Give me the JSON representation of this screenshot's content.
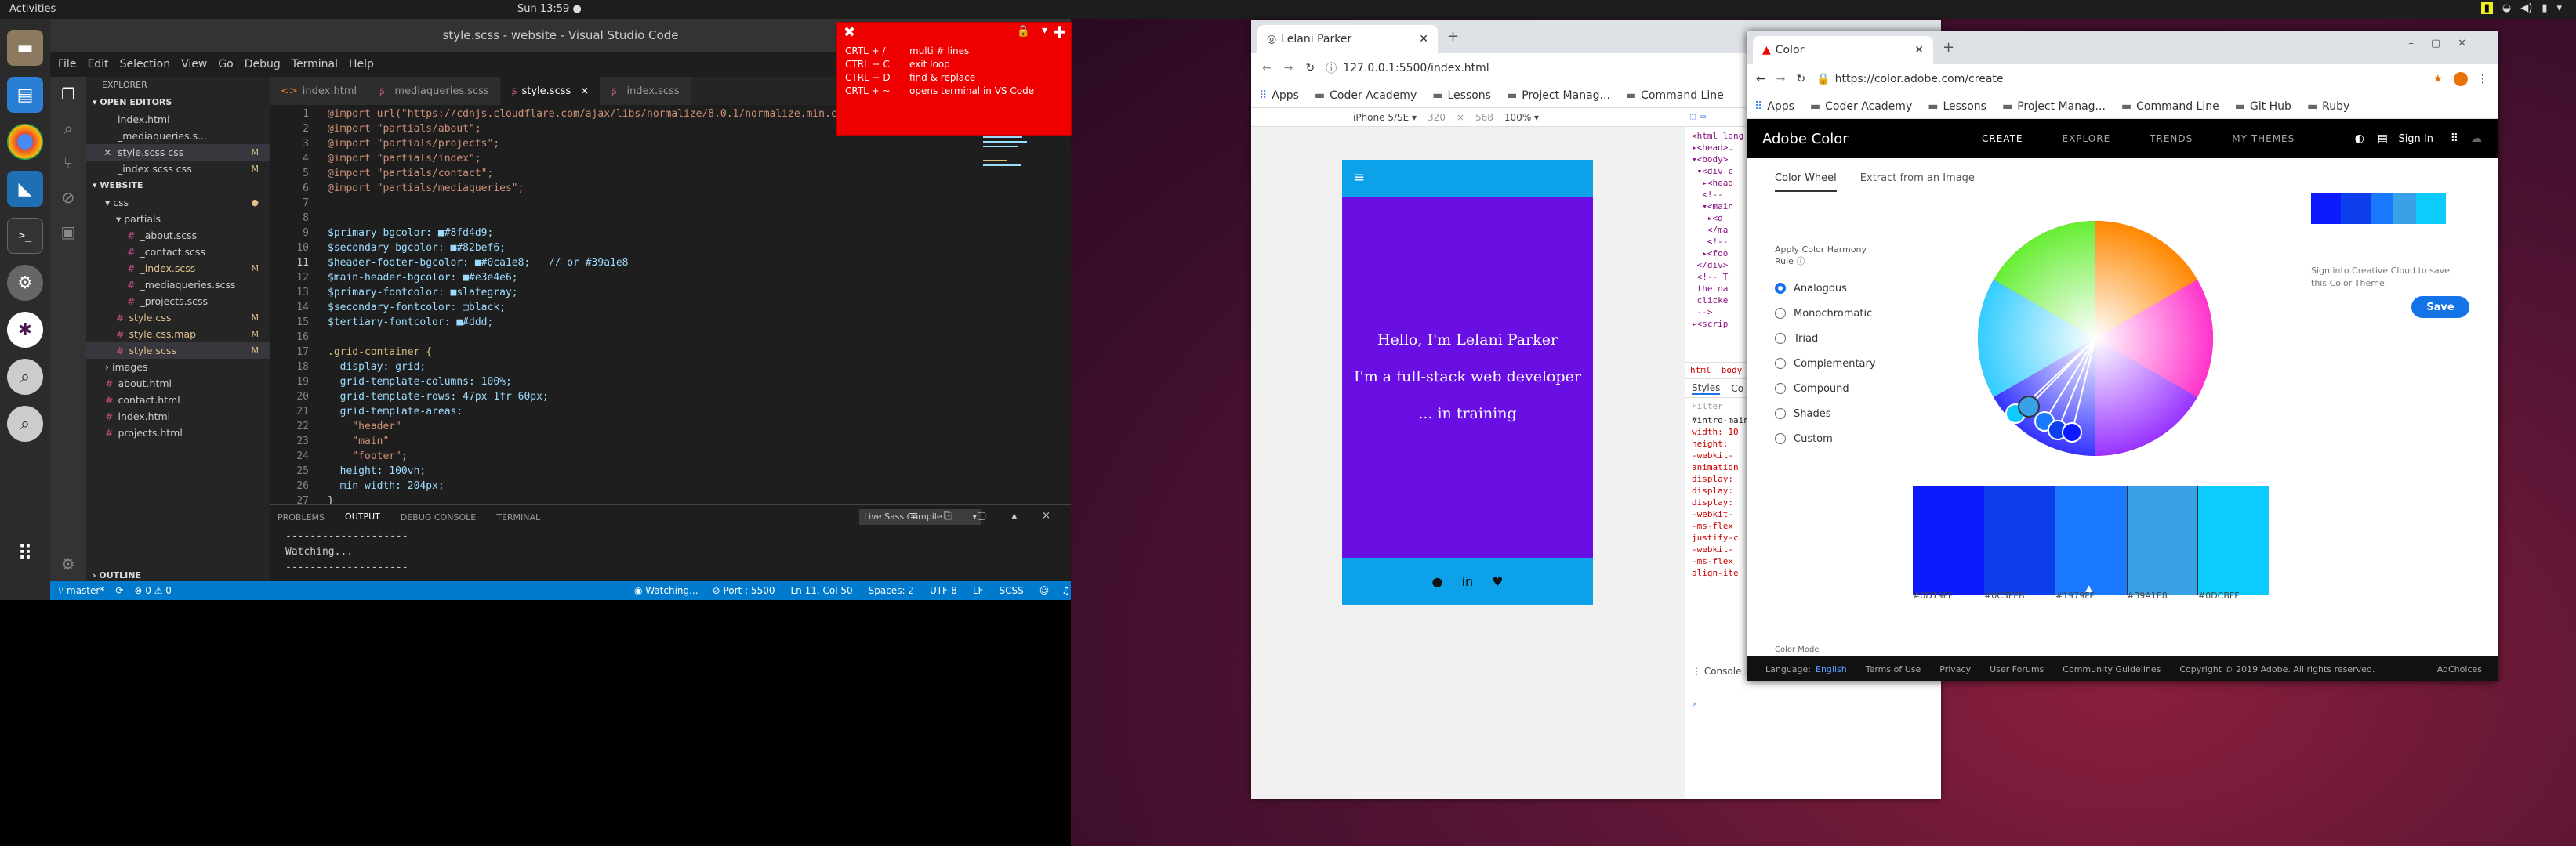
{
  "topbar": {
    "activities": "Activities",
    "clock": "Sun 13:59 ●"
  },
  "dock": {
    "icons": [
      "files-icon",
      "writer-icon",
      "chrome-icon",
      "vscode-icon",
      "terminal-icon",
      "settings-icon",
      "slack-icon",
      "search-icon",
      "search2-icon"
    ]
  },
  "vscode": {
    "title": "style.scss - website - Visual Studio Code",
    "menu": [
      "File",
      "Edit",
      "Selection",
      "View",
      "Go",
      "Debug",
      "Terminal",
      "Help"
    ],
    "explorer_label": "EXPLORER",
    "open_editors_label": "OPEN EDITORS",
    "website_label": "WEBSITE",
    "outline_label": "OUTLINE",
    "open_editors": [
      {
        "name": "index.html",
        "m": ""
      },
      {
        "name": "_mediaqueries.s...",
        "m": ""
      },
      {
        "name": "style.scss css",
        "m": "M"
      },
      {
        "name": "_index.scss css",
        "m": "M"
      }
    ],
    "tree": [
      {
        "name": "css",
        "indent": 1,
        "m": "●",
        "folder": true
      },
      {
        "name": "partials",
        "indent": 2,
        "m": "",
        "folder": true
      },
      {
        "name": "_about.scss",
        "indent": 3,
        "m": ""
      },
      {
        "name": "_contact.scss",
        "indent": 3,
        "m": ""
      },
      {
        "name": "_index.scss",
        "indent": 3,
        "m": "M"
      },
      {
        "name": "_mediaqueries.scss",
        "indent": 3,
        "m": ""
      },
      {
        "name": "_projects.scss",
        "indent": 3,
        "m": ""
      },
      {
        "name": "style.css",
        "indent": 2,
        "m": "M"
      },
      {
        "name": "style.css.map",
        "indent": 2,
        "m": "M"
      },
      {
        "name": "style.scss",
        "indent": 2,
        "m": "M"
      },
      {
        "name": "images",
        "indent": 1,
        "m": "",
        "folder": true
      },
      {
        "name": "about.html",
        "indent": 1,
        "m": ""
      },
      {
        "name": "contact.html",
        "indent": 1,
        "m": ""
      },
      {
        "name": "index.html",
        "indent": 1,
        "m": ""
      },
      {
        "name": "projects.html",
        "indent": 1,
        "m": ""
      }
    ],
    "tabs": [
      "index.html",
      "_mediaqueries.scss",
      "style.scss",
      "_index.scss"
    ],
    "code": [
      "@import url(\"https://cdnjs.cloudflare.com/ajax/libs/normalize/8.0.1/normalize.min.css\");",
      "@import \"partials/about\";",
      "@import \"partials/projects\";",
      "@import \"partials/index\";",
      "@import \"partials/contact\";",
      "@import \"partials/mediaqueries\";",
      "",
      "",
      "$primary-bgcolor: ■#8fd4d9;",
      "$secondary-bgcolor: ■#82bef6;",
      "$header-footer-bgcolor: ■#0ca1e8;   // or #39a1e8",
      "$main-header-bgcolor: ■#e3e4e6;",
      "$primary-fontcolor: ■slategray;",
      "$secondary-fontcolor: □black;",
      "$tertiary-fontcolor: ■#ddd;",
      "",
      ".grid-container {",
      "  display: grid;",
      "  grid-template-columns: 100%;",
      "  grid-template-rows: 47px 1fr 60px;",
      "  grid-template-areas:",
      "    \"header\"",
      "    \"main\"",
      "    \"footer\";",
      "  height: 100vh;",
      "  min-width: 204px;",
      "}"
    ],
    "panel_tabs": [
      "PROBLEMS",
      "OUTPUT",
      "DEBUG CONSOLE",
      "TERMINAL"
    ],
    "panel_select": "Live Sass Compile",
    "panel_lines": [
      "--------------------",
      "Watching...",
      "--------------------"
    ],
    "status": {
      "branch": "master*",
      "errors": "⊗ 0 ⚠ 0",
      "watching": "Watching...",
      "port": "Port : 5500",
      "position": "Ln 11, Col 50",
      "spaces": "Spaces: 2",
      "encoding": "UTF-8",
      "eol": "LF",
      "lang": "SCSS"
    }
  },
  "popup": {
    "rows": [
      {
        "key": "CRTL + /",
        "desc": "multi # lines"
      },
      {
        "key": "CTRL + C",
        "desc": "exit loop"
      },
      {
        "key": "CTRL + D",
        "desc": "find & replace"
      },
      {
        "key": "CRTL + ~",
        "desc": "opens terminal in VS Code"
      }
    ]
  },
  "chrome1": {
    "tab_title": "Lelani Parker",
    "url": "127.0.0.1:5500/index.html",
    "bookmarks": [
      "Apps",
      "Coder Academy",
      "Lessons",
      "Project Manag...",
      "Command Line"
    ],
    "device": "iPhone 5/SE ▾",
    "width": "320",
    "height": "568",
    "zoom": "100% ▾",
    "hero": [
      "Hello, I'm Lelani Parker",
      "I'm a full-stack web developer",
      "... in training"
    ],
    "devtools_tabs": [
      "Styles",
      "Co"
    ],
    "filter": "Filter",
    "css_lines": [
      "#intro-main",
      "width: 10",
      "height:",
      "-webkit-",
      "animation",
      "display:",
      "display:",
      "display:",
      "-webkit-",
      "-ms-flex",
      "justify-c",
      "-webkit-",
      "-ms-flex",
      "align-ite"
    ],
    "console": "Console"
  },
  "chrome2": {
    "tab_title": "Color",
    "url": "https://color.adobe.com/create",
    "bookmarks": [
      "Apps",
      "Coder Academy",
      "Lessons",
      "Project Manag...",
      "Command Line",
      "Git Hub",
      "Ruby"
    ],
    "brand": "Adobe Color",
    "nav": [
      "CREATE",
      "EXPLORE",
      "TRENDS",
      "MY THEMES"
    ],
    "signin": "Sign In",
    "subtabs": [
      "Color Wheel",
      "Extract from an Image"
    ],
    "harmony_label": "Apply Color Harmony Rule",
    "rules": [
      "Analogous",
      "Monochromatic",
      "Triad",
      "Complementary",
      "Compound",
      "Shades",
      "Custom"
    ],
    "swatches": [
      "#0D19FF",
      "#0C3FEB",
      "#1979FF",
      "#39A1E8",
      "#0DCBFF"
    ],
    "side_text": "Sign into Creative Cloud to save this Color Theme.",
    "save": "Save",
    "color_mode": "Color Mode",
    "footer": [
      "Language:",
      "English",
      "Terms of Use",
      "Privacy",
      "User Forums",
      "Community Guidelines",
      "Copyright © 2019 Adobe. All rights reserved.",
      "AdChoices"
    ]
  }
}
